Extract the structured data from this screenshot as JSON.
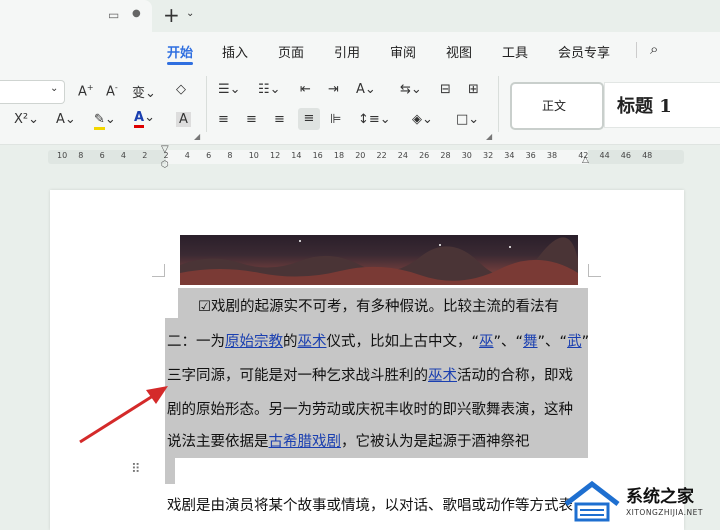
{
  "menu": [
    "开始",
    "插入",
    "页面",
    "引用",
    "审阅",
    "视图",
    "工具",
    "会员专享"
  ],
  "active_menu": "开始",
  "styles": {
    "normal": "正文",
    "heading1": "标题 1"
  },
  "ruler_numbers": [
    "10",
    "8",
    "6",
    "4",
    "2",
    "2",
    "4",
    "6",
    "8",
    "10",
    "12",
    "14",
    "16",
    "18",
    "20",
    "22",
    "24",
    "26",
    "28",
    "30",
    "32",
    "34",
    "36",
    "38",
    "42",
    "44",
    "46",
    "48"
  ],
  "doc": {
    "line1": "☑戏剧的起源实不可考，有多种假说。比较主流的看法有",
    "line2": {
      "a": "二：一为",
      "l1": "原始宗教",
      "b": "的",
      "l2": "巫术",
      "c": "仪式，比如上古中文，“",
      "l3": "巫",
      "d": "”、“",
      "l4": "舞",
      "e": "”、“",
      "l5": "武",
      "f": "”"
    },
    "line3": {
      "a": "三字同源，可能是对一种乞求战斗胜利的",
      "l1": "巫术",
      "b": "活动的合称，即戏"
    },
    "line4": "剧的原始形态。另一为劳动或庆祝丰收时的即兴歌舞表演，这种",
    "line5": {
      "a": "说法主要依据是",
      "l1": "古希腊戏剧",
      "b": "，它被认为是起源于酒神祭祀"
    },
    "line6": "戏剧是由演员将某个故事或情境，以对话、歌唱或动作等方式表"
  },
  "watermark": {
    "title": "系统之家",
    "url": "XITONGZHIJIA.NET"
  },
  "colors": {
    "accent": "#2f6fe0",
    "link": "#1a3fb0",
    "selection": "#c6c6c6",
    "arrow": "#d42a2a"
  }
}
